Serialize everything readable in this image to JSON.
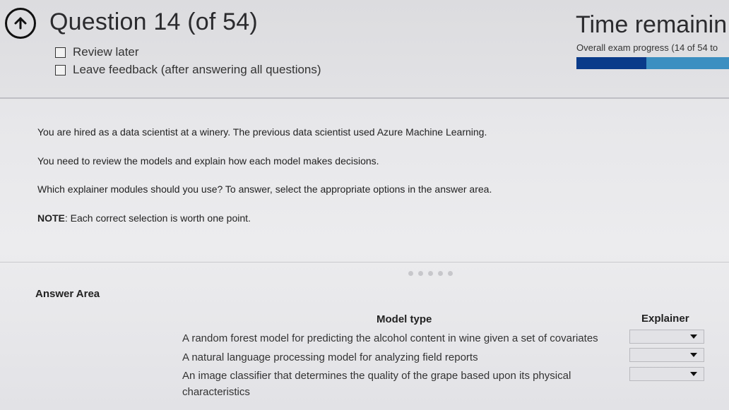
{
  "header": {
    "question_title": "Question 14 (of 54)",
    "review_later_label": "Review later",
    "leave_feedback_label": "Leave feedback (after answering all questions)",
    "time_remaining_label": "Time remainin",
    "progress_label": "Overall exam progress (14 of 54 to",
    "progress_fraction": 0.46,
    "progress_colors": {
      "fill": "#0a3b8a",
      "track": "#3c8fc1"
    }
  },
  "question": {
    "paragraph_1": "You are hired as a data scientist at a winery. The previous data scientist used Azure Machine Learning.",
    "paragraph_2": "You need to review the models and explain how each model makes decisions.",
    "paragraph_3": "Which explainer modules should you use? To answer, select the appropriate options in the answer area.",
    "note_label": "NOTE",
    "note_text": ": Each correct selection is worth one point."
  },
  "answer_area": {
    "title": "Answer Area",
    "model_type_header": "Model type",
    "explainer_header": "Explainer",
    "rows": [
      {
        "model": "A random forest model for predicting the alcohol content in wine given a set of covariates",
        "explainer_value": ""
      },
      {
        "model": "A natural language processing model for analyzing field reports",
        "explainer_value": ""
      },
      {
        "model": "An image classifier that determines the quality of the grape based upon its physical characteristics",
        "explainer_value": ""
      }
    ]
  },
  "icons": {
    "back": "arrow-up-circle-icon",
    "dropdown": "chevron-down-icon"
  }
}
